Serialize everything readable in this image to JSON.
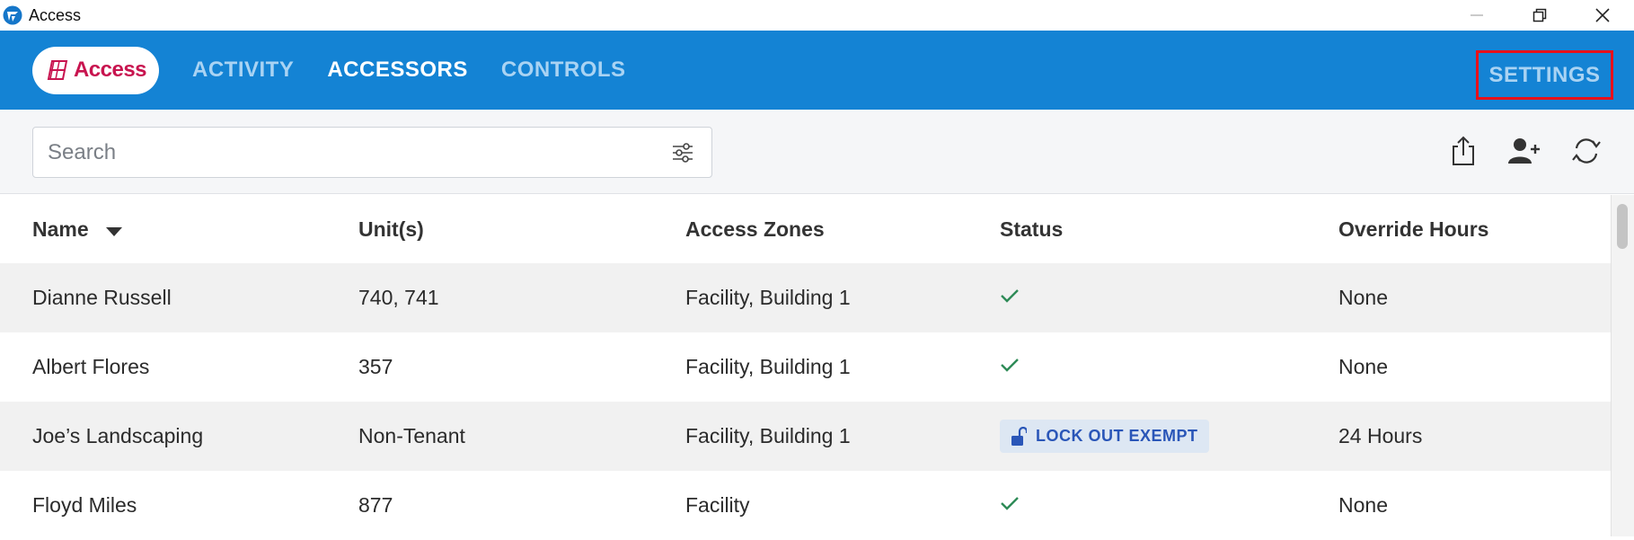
{
  "window": {
    "title": "Access",
    "icon": "access-app-icon",
    "controls": [
      "minimize-icon",
      "restore-icon",
      "close-icon"
    ]
  },
  "nav": {
    "logo_text": "Access",
    "tabs": [
      {
        "label": "ACTIVITY",
        "active": false
      },
      {
        "label": "ACCESSORS",
        "active": true
      },
      {
        "label": "CONTROLS",
        "active": false
      }
    ],
    "settings_label": "SETTINGS",
    "brand_color": "#1483d4",
    "logo_color": "#c8144f"
  },
  "toolbar": {
    "search_placeholder": "Search",
    "search_value": "",
    "icons": [
      "filter-icon",
      "export-icon",
      "add-user-icon",
      "refresh-icon"
    ]
  },
  "table": {
    "headers": [
      "Name",
      "Unit(s)",
      "Access Zones",
      "Status",
      "Override Hours"
    ],
    "sort": {
      "column": "Name",
      "direction": "descending"
    },
    "rows": [
      {
        "name": "Dianne Russell",
        "units": "740, 741",
        "zones": "Facility, Building 1",
        "status": "check",
        "override": "None"
      },
      {
        "name": "Albert Flores",
        "units": "357",
        "zones": "Facility, Building 1",
        "status": "check",
        "override": "None"
      },
      {
        "name": "Joe’s Landscaping",
        "units": "Non-Tenant",
        "zones": "Facility, Building 1",
        "status": "LOCK OUT EXEMPT",
        "override": "24 Hours"
      },
      {
        "name": "Floyd Miles",
        "units": "877",
        "zones": "Facility",
        "status": "check",
        "override": "None"
      }
    ]
  }
}
